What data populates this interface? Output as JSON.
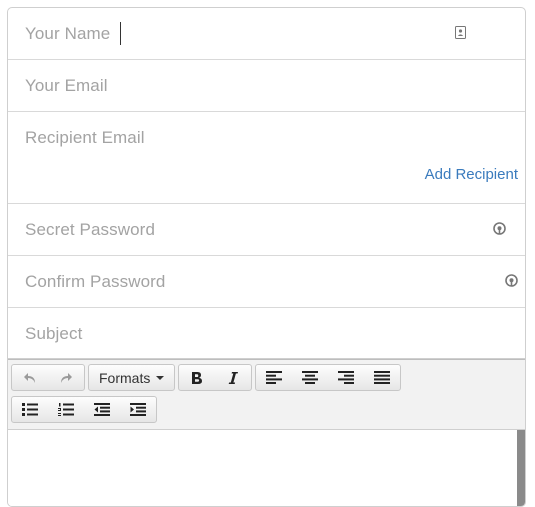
{
  "form": {
    "name_placeholder": "Your Name",
    "email_placeholder": "Your Email",
    "recipient_placeholder": "Recipient Email",
    "add_recipient_label": "Add Recipient",
    "password_placeholder": "Secret Password",
    "confirm_password_placeholder": "Confirm Password",
    "subject_placeholder": "Subject"
  },
  "editor": {
    "formats_label": "Formats",
    "toolbar_icons": [
      "undo-icon",
      "redo-icon",
      "bold-icon",
      "italic-icon",
      "align-left-icon",
      "align-center-icon",
      "align-right-icon",
      "align-justify-icon",
      "bullet-list-icon",
      "numbered-list-icon",
      "outdent-icon",
      "indent-icon"
    ]
  },
  "colors": {
    "placeholder": "#a3a3a3",
    "link": "#3a7bbd",
    "border": "#d9d9d9"
  }
}
